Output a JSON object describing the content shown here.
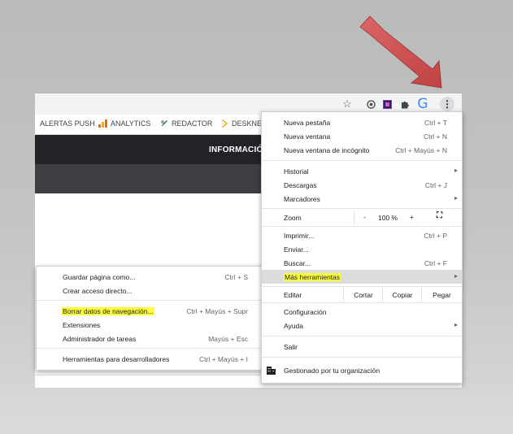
{
  "colors": {
    "highlight": "#fbff3a",
    "red_arrow": "#d94c4c",
    "dark_bar": "#222326",
    "grey_bar": "#3c3e44"
  },
  "toolbar": {
    "icons": [
      "star-icon",
      "circle-extension-icon",
      "purple-extension-icon",
      "puzzle-extensions-icon",
      "google-icon",
      "three-dot-menu-icon"
    ],
    "google_letter": "G",
    "menu_glyph": "⋮"
  },
  "bookmarks": [
    {
      "label": "ALERTAS PUSH"
    },
    {
      "label": "ANALYTICS"
    },
    {
      "label": "REDACTOR"
    },
    {
      "label": "DESKNE"
    }
  ],
  "page": {
    "header_title": "INFORMACIÓ"
  },
  "main_menu": {
    "new_tab": {
      "label": "Nueva pestaña",
      "shortcut": "Ctrl + T"
    },
    "new_window": {
      "label": "Nueva ventana",
      "shortcut": "Ctrl + N"
    },
    "incognito": {
      "label": "Nueva ventana de incógnito",
      "shortcut": "Ctrl + Mayús + N"
    },
    "history": {
      "label": "Historial"
    },
    "downloads": {
      "label": "Descargas",
      "shortcut": "Ctrl + J"
    },
    "bookmarks": {
      "label": "Marcadores"
    },
    "zoom": {
      "label": "Zoom",
      "minus": "-",
      "percent": "100 %",
      "plus": "+",
      "fullscreen": "⛶"
    },
    "print": {
      "label": "Imprimir...",
      "shortcut": "Ctrl + P"
    },
    "send": {
      "label": "Enviar..."
    },
    "find": {
      "label": "Buscar...",
      "shortcut": "Ctrl + F"
    },
    "more_tools": {
      "label": "Más herramientas"
    },
    "edit": {
      "label": "Editar",
      "cut": "Cortar",
      "copy": "Copiar",
      "paste": "Pegar"
    },
    "settings": {
      "label": "Configuración"
    },
    "help": {
      "label": "Ayuda"
    },
    "exit": {
      "label": "Salir"
    },
    "managed": {
      "label": "Gestionado por tu organización"
    }
  },
  "sub_menu": {
    "save_page": {
      "label": "Guardar página como...",
      "shortcut": "Ctrl + S"
    },
    "create_shortcut": {
      "label": "Crear acceso directo..."
    },
    "clear_data": {
      "label": "Borrar datos de navegación...",
      "shortcut": "Ctrl + Mayús + Supr"
    },
    "extensions": {
      "label": "Extensiones"
    },
    "task_manager": {
      "label": "Administrador de tareas",
      "shortcut": "Mayús + Esc"
    },
    "dev_tools": {
      "label": "Herramientas para desarrolladores",
      "shortcut": "Ctrl + Mayús + I"
    }
  }
}
